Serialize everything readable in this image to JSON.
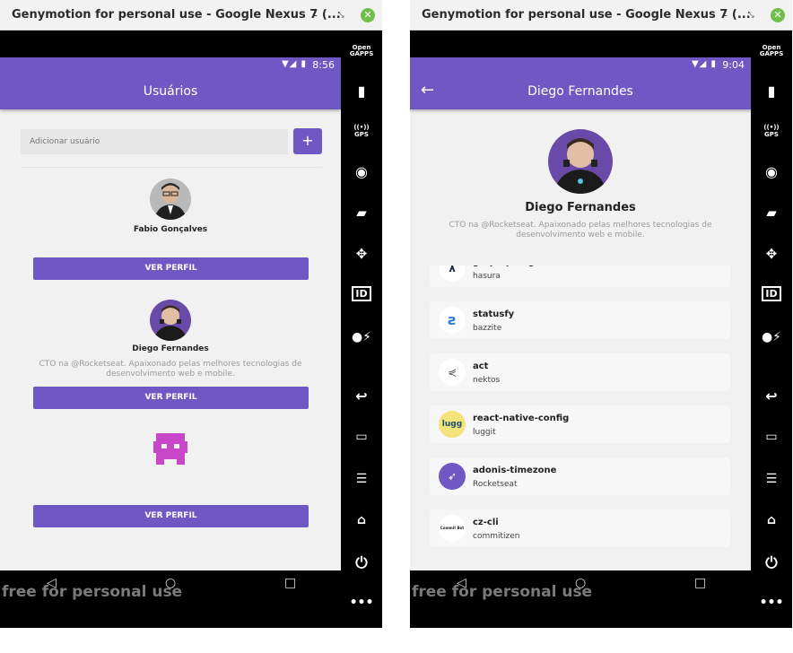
{
  "window_title": "Genymotion for personal use - Google Nexus 7 (...",
  "watermark": "free for personal use",
  "colors": {
    "accent": "#7058c4",
    "background": "#f1f1f1"
  },
  "sidebar": {
    "open_gapps": [
      "Open",
      "GAPPS"
    ],
    "gps": "GPS",
    "id": "ID"
  },
  "left_screen": {
    "time": "8:56",
    "title": "Usuários",
    "add_placeholder": "Adicionar usuário",
    "add_button": "+",
    "users": [
      {
        "name": "Fabio Gonçalves",
        "bio": "",
        "button": "VER PERFIL"
      },
      {
        "name": "Diego Fernandes",
        "bio": "CTO na @Rocketseat. Apaixonado pelas melhores tecnologias de desenvolvimento web e mobile.",
        "button": "VER PERFIL"
      },
      {
        "name": "",
        "bio": "",
        "button": "VER PERFIL"
      }
    ]
  },
  "right_screen": {
    "time": "9:04",
    "title": "Diego Fernandes",
    "name": "Diego Fernandes",
    "bio": "CTO na @Rocketseat. Apaixonado pelas melhores tecnologias de desenvolvimento web e mobile.",
    "repos": [
      {
        "name": "graphql-engine",
        "owner": "hasura",
        "logo": "hasura-logo"
      },
      {
        "name": "statusfy",
        "owner": "bazzite",
        "logo": "statusfy-logo"
      },
      {
        "name": "act",
        "owner": "nektos",
        "logo": "act-logo"
      },
      {
        "name": "react-native-config",
        "owner": "luggit",
        "logo": "lugg-logo",
        "logo_text": "lugg"
      },
      {
        "name": "adonis-timezone",
        "owner": "Rocketseat",
        "logo": "rocketseat-logo"
      },
      {
        "name": "cz-cli",
        "owner": "commitizen",
        "logo": "commitizen-logo",
        "logo_text": "Commit Bot"
      }
    ]
  }
}
